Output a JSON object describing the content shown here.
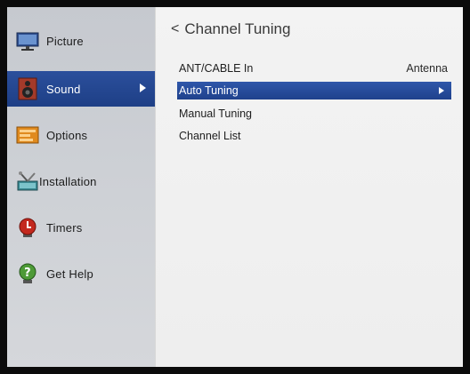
{
  "sidebar": {
    "items": [
      {
        "label": "Picture",
        "icon": "monitor-icon"
      },
      {
        "label": "Sound",
        "icon": "speaker-icon",
        "selected": true
      },
      {
        "label": "Options",
        "icon": "options-icon"
      },
      {
        "label": "Installation",
        "icon": "installation-tools-icon"
      },
      {
        "label": "Timers",
        "icon": "timer-icon"
      },
      {
        "label": "Get Help",
        "icon": "help-icon"
      }
    ]
  },
  "panel": {
    "back_glyph": "<",
    "title": "Channel Tuning",
    "rows": [
      {
        "label": "ANT/CABLE In",
        "value": "Antenna"
      },
      {
        "label": "Auto Tuning",
        "selected": true
      },
      {
        "label": "Manual Tuning"
      },
      {
        "label": "Channel List"
      }
    ]
  },
  "colors": {
    "selection": "#1f418c",
    "sidebar_bg": "#cdd0d5",
    "panel_bg": "#f0f0f0",
    "frame": "#0b0b0b"
  }
}
